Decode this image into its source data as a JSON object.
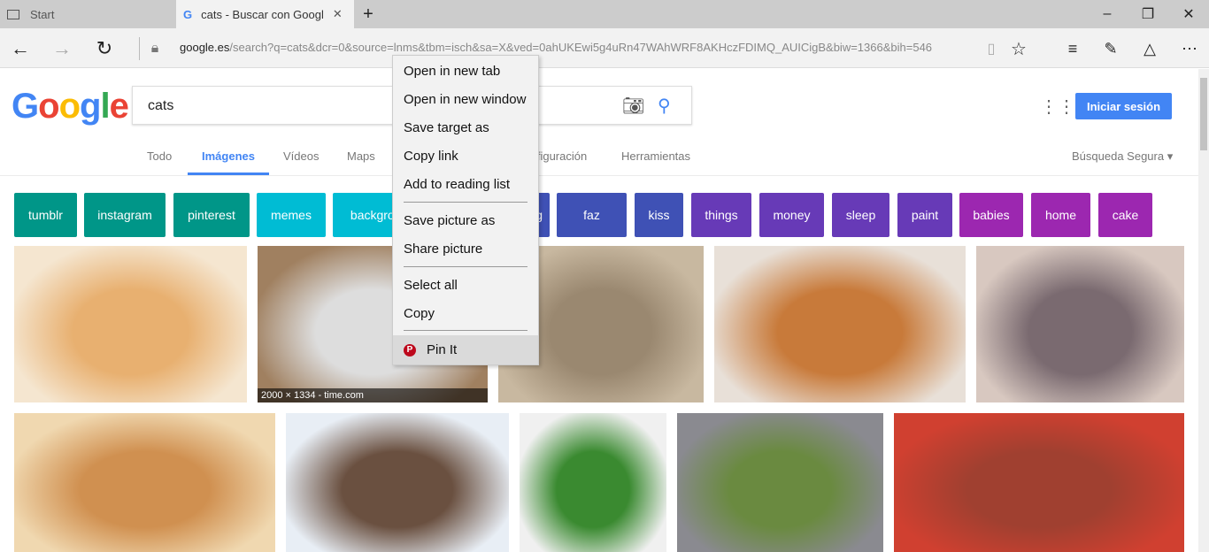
{
  "browser": {
    "tabs": [
      {
        "label": "Start",
        "icon": "start-page-icon"
      },
      {
        "label": "cats - Buscar con Googl",
        "icon": "google-favicon"
      }
    ],
    "url_host": "google.es",
    "url_path": "/search?q=cats&dcr=0&source=lnms&tbm=isch&sa=X&ved=0ahUKEwi5g4uRn47WAhWRF8AKHczFDIMQ_AUICigB&biw=1366&bih=546"
  },
  "google": {
    "logo": "Google",
    "query": "cats",
    "signin": "Iniciar sesión",
    "tabs": [
      "Todo",
      "Imágenes",
      "Vídeos",
      "Maps",
      "Configuración",
      "Herramientas"
    ],
    "active_tab": "Imágenes",
    "safe_search": "Búsqueda Segura",
    "chips": [
      {
        "label": "tumblr",
        "color": "#009688"
      },
      {
        "label": "instagram",
        "color": "#009688"
      },
      {
        "label": "pinterest",
        "color": "#009688"
      },
      {
        "label": "memes",
        "color": "#00bcd4"
      },
      {
        "label": "backgrounds",
        "color": "#00bcd4"
      },
      {
        "label": "dancing",
        "color": "#3f51b5"
      },
      {
        "label": "faz",
        "color": "#3f51b5"
      },
      {
        "label": "kiss",
        "color": "#3f51b5"
      },
      {
        "label": "things",
        "color": "#673ab7"
      },
      {
        "label": "money",
        "color": "#673ab7"
      },
      {
        "label": "sleep",
        "color": "#673ab7"
      },
      {
        "label": "paint",
        "color": "#673ab7"
      },
      {
        "label": "babies",
        "color": "#9c27b0"
      },
      {
        "label": "home",
        "color": "#9c27b0"
      },
      {
        "label": "cake",
        "color": "#9c27b0"
      }
    ],
    "image_caption": "2000 × 1334 - time.com"
  },
  "context_menu": {
    "items": [
      "Open in new tab",
      "Open in new window",
      "Save target as",
      "Copy link",
      "Add to reading list",
      "Save picture as",
      "Share picture",
      "Select all",
      "Copy",
      "Pin It"
    ],
    "highlighted": "Pin It"
  }
}
